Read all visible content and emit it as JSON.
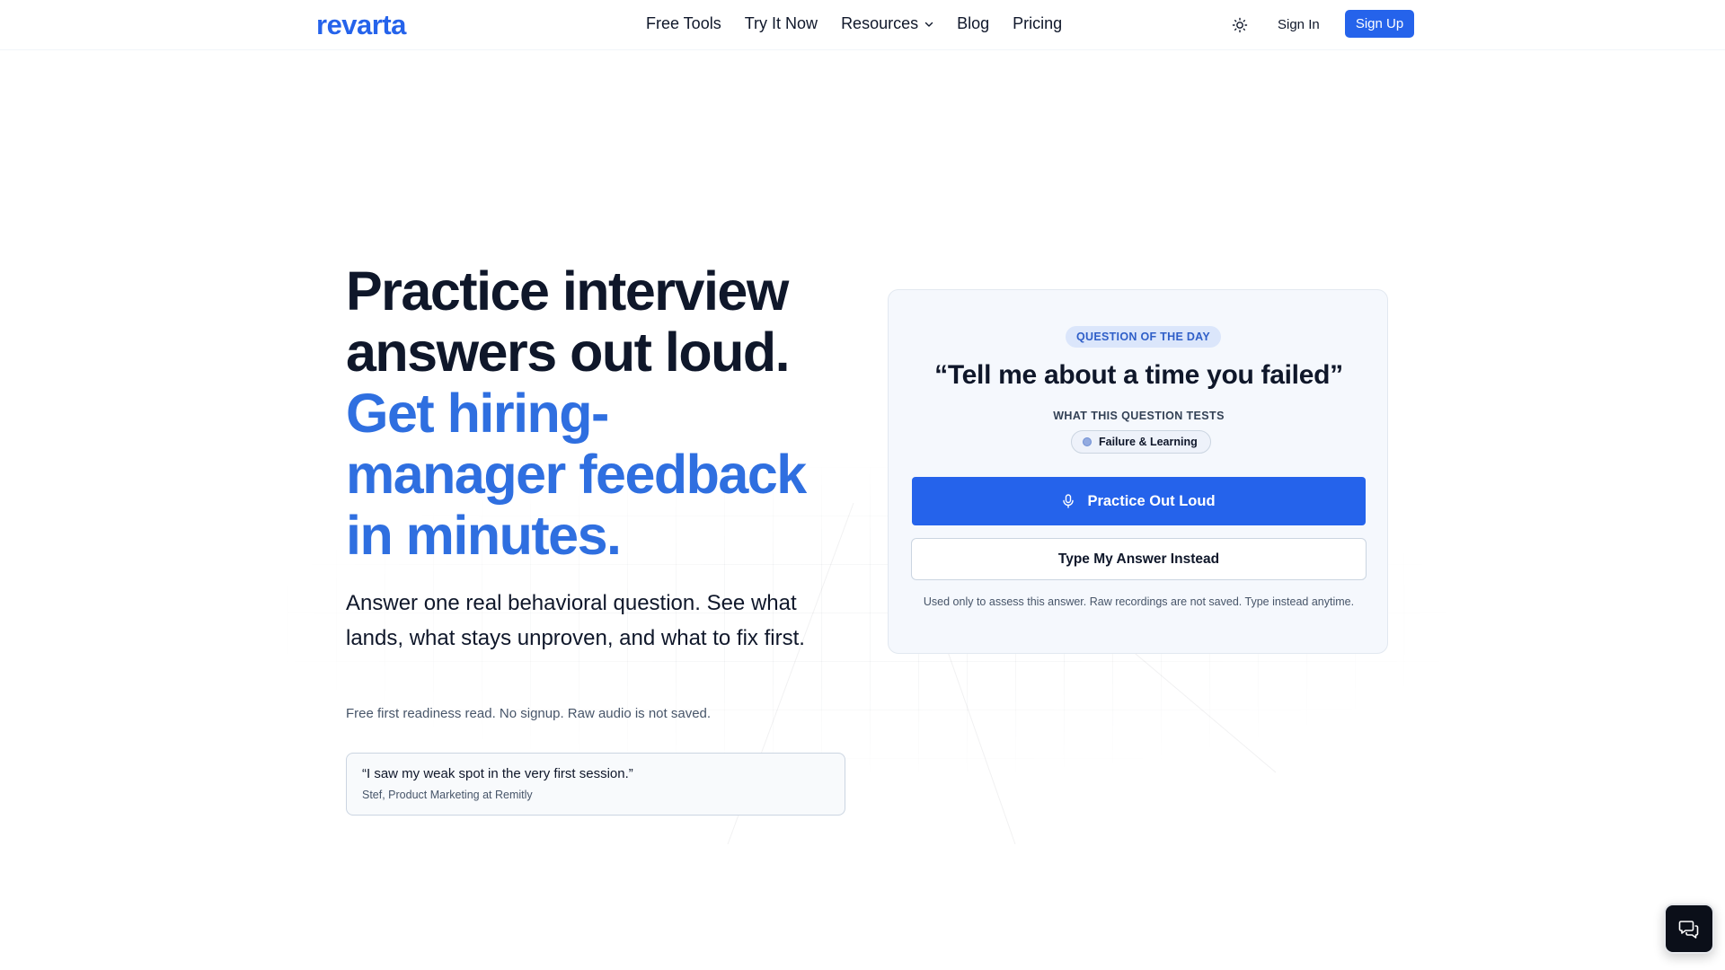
{
  "header": {
    "logo": "revarta",
    "nav": {
      "free_tools": "Free Tools",
      "try_it_now": "Try It Now",
      "resources": "Resources",
      "blog": "Blog",
      "pricing": "Pricing"
    },
    "sign_in": "Sign In",
    "sign_up": "Sign Up"
  },
  "hero": {
    "title_line1": "Practice interview",
    "title_line2": "answers out loud.",
    "accent_line1": "Get hiring-",
    "accent_line2": "manager feedback",
    "accent_line3": "in minutes.",
    "subtitle": "Answer one real behavioral question. See what lands, what stays unproven, and what to fix first.",
    "note": "Free first readiness read. No signup. Raw audio is not saved.",
    "testimonial": {
      "quote": "“I saw my weak spot in the very first session.”",
      "author": "Stef, Product Marketing at Remitly"
    }
  },
  "question_card": {
    "badge": "QUESTION OF THE DAY",
    "question": "“Tell me about a time you failed”",
    "tests_label": "WHAT THIS QUESTION TESTS",
    "tag": "Failure & Learning",
    "practice_button": "Practice Out Loud",
    "type_button": "Type My Answer Instead",
    "privacy_note": "Used only to assess this answer. Raw recordings are not saved. Type instead anytime."
  },
  "colors": {
    "brand": "#2563eb",
    "accent_text": "#2f6fe0",
    "card_bg": "#f5f8fd"
  },
  "icons": {
    "theme": "sun-icon",
    "chevron": "chevron-down-icon",
    "mic": "microphone-icon",
    "chat": "chat-icon"
  }
}
